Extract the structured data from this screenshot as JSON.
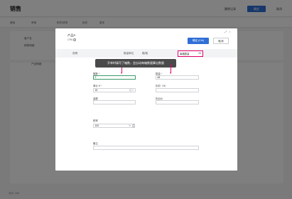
{
  "background": {
    "title": "销售",
    "header_actions": [
      "删除记录",
      "确定",
      "取消"
    ],
    "toolbar": [
      "基础",
      "审核",
      "附件/修改",
      "相关",
      "更多"
    ],
    "labels": [
      "客户名",
      "销售明细"
    ],
    "section_label": "产品明细",
    "footer": "共计: 200"
  },
  "dialog": {
    "title": "产品A",
    "subtitle": "CPA",
    "controls": [
      "⤢",
      "×"
    ],
    "ok_button": "确定 (Ctrl)",
    "cancel_button": "取消",
    "info_bar": {
      "label1": "说明",
      "label2": "数量单位",
      "value2": "箱/瓶",
      "qty_label": "每箱数量",
      "qty_value": "24"
    },
    "tooltip": "开单时填写了箱数，会自动每箱数量算出数量",
    "fields": {
      "boxes_label": "箱数 *",
      "boxes_value": "2",
      "quantity_label": "数量 *",
      "quantity_value": "48",
      "price_label": "单价 ¥ *",
      "price_value": "15",
      "price_suffix": "元/1",
      "discount_label": "折扣（%）",
      "amount_label": "金额",
      "discount_price_label": "折后价",
      "rate_label": "税率",
      "rate_value": "100",
      "rate_suffix": "%",
      "remark_label": "备注"
    }
  },
  "colors": {
    "primary": "#2f6fd6",
    "highlight": "#e0006a",
    "active_border": "#3a9a6a"
  }
}
